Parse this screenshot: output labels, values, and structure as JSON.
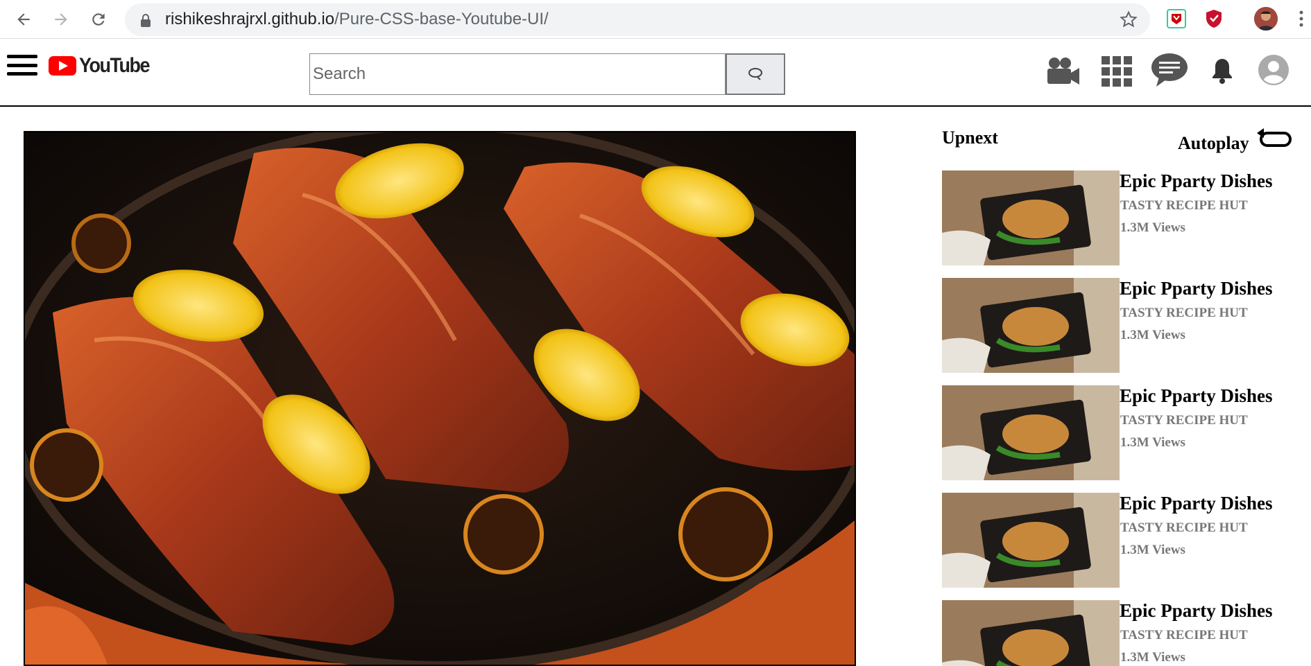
{
  "browser": {
    "url_host": "rishikeshrajrxl.github.io",
    "url_path": "/Pure-CSS-base-Youtube-UI/"
  },
  "header": {
    "logo_text": "YouTube",
    "search_placeholder": "Search"
  },
  "sidebar": {
    "upnext_label": "Upnext",
    "autoplay_label": "Autoplay",
    "videos": [
      {
        "title": "Epic Pparty Dishes",
        "channel": "TASTY RECIPE HUT",
        "views": "1.3M Views"
      },
      {
        "title": "Epic Pparty Dishes",
        "channel": "TASTY RECIPE HUT",
        "views": "1.3M Views"
      },
      {
        "title": "Epic Pparty Dishes",
        "channel": "TASTY RECIPE HUT",
        "views": "1.3M Views"
      },
      {
        "title": "Epic Pparty Dishes",
        "channel": "TASTY RECIPE HUT",
        "views": "1.3M Views"
      },
      {
        "title": "Epic Pparty Dishes",
        "channel": "TASTY RECIPE HUT",
        "views": "1.3M Views"
      }
    ]
  },
  "colors": {
    "brand_red": "#ff0000",
    "text_gray": "#777777"
  }
}
